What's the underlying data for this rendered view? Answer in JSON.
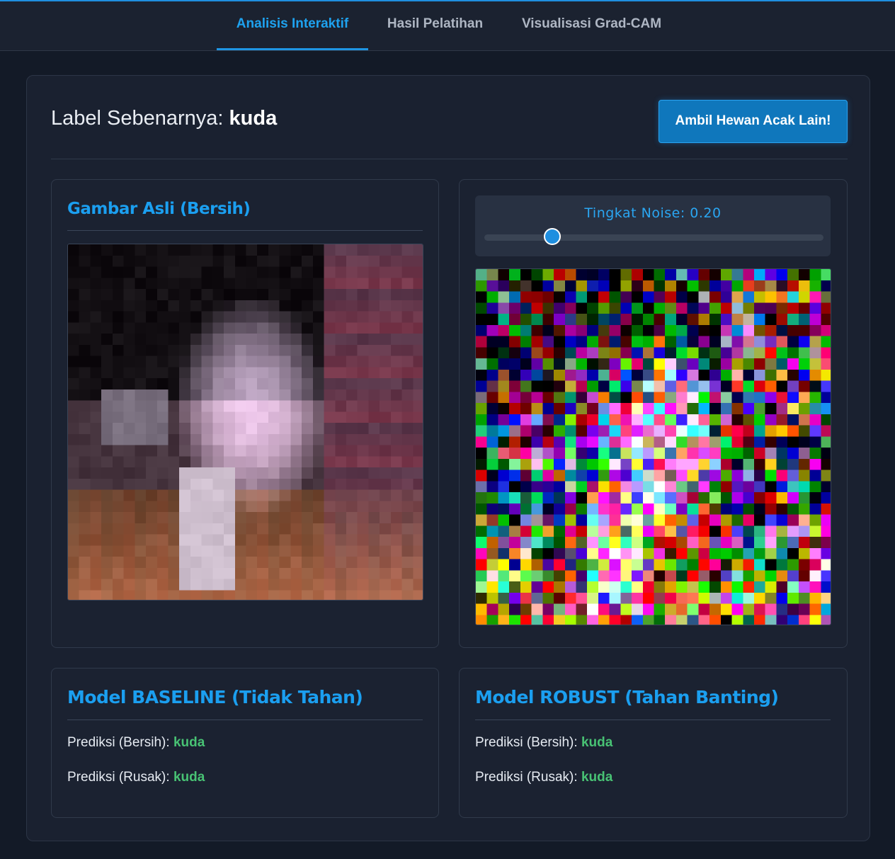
{
  "tabs": [
    {
      "label": "Analisis Interaktif",
      "active": true
    },
    {
      "label": "Hasil Pelatihan",
      "active": false
    },
    {
      "label": "Visualisasi Grad-CAM",
      "active": false
    }
  ],
  "header": {
    "label_prefix": "Label Sebenarnya:",
    "label_value": "kuda",
    "random_button": "Ambil Hewan Acak Lain!"
  },
  "original_card": {
    "title": "Gambar Asli (Bersih)",
    "image_icon": "horse-photo-pixelated"
  },
  "noise_card": {
    "label_prefix": "Tingkat Noise:",
    "value": "0.20",
    "slider_fraction": 0.2,
    "image_icon": "noisy-horse-photo"
  },
  "baseline_card": {
    "title": "Model BASELINE (Tidak Tahan)",
    "clean_label": "Prediksi (Bersih):",
    "clean_value": "kuda",
    "noisy_label": "Prediksi (Rusak):",
    "noisy_value": "kuda"
  },
  "robust_card": {
    "title": "Model ROBUST (Tahan Banting)",
    "clean_label": "Prediksi (Bersih):",
    "clean_value": "kuda",
    "noisy_label": "Prediksi (Rusak):",
    "noisy_value": "kuda"
  },
  "colors": {
    "accent": "#1b9ff0",
    "prediction": "#48c274",
    "button": "#0f77bc",
    "background": "#131a27"
  }
}
